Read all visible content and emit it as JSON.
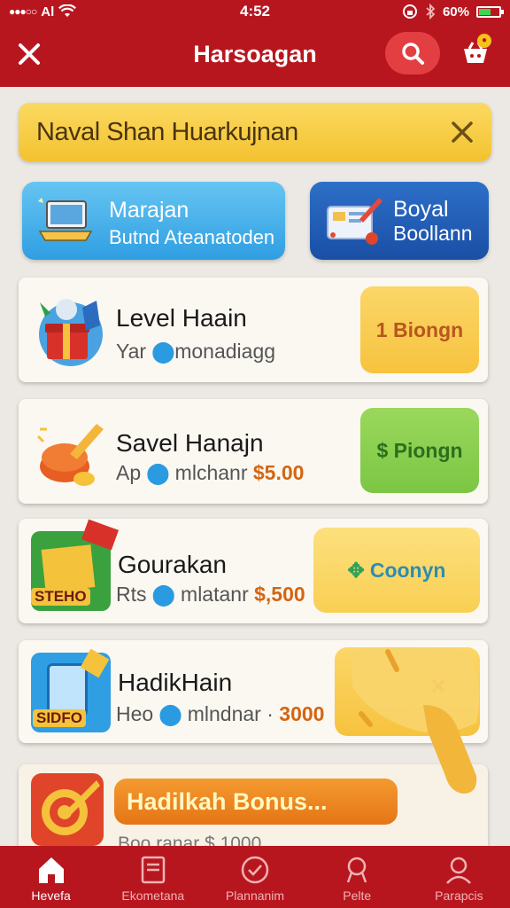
{
  "status_bar": {
    "carrier": "Al",
    "time": "4:52",
    "battery_text": "60%",
    "battery_level": 0.6
  },
  "header": {
    "title": "Harsoagan"
  },
  "banner": {
    "text": "Naval Shan Huarkujnan"
  },
  "quick_cards": [
    {
      "title": "Marajan",
      "subtitle": "Butnd Ateanatoden"
    },
    {
      "title": "Boyal",
      "subtitle": "Boollann"
    }
  ],
  "items": [
    {
      "title": "Level Haain",
      "sub_prefix": "Yar",
      "sub_text": "monadiagg",
      "price": "",
      "action": "1 Biongn"
    },
    {
      "title": "Savel Hanajn",
      "sub_prefix": "Ap",
      "sub_text": "mlchanr",
      "price": "$5.00",
      "action": "$ Piongn"
    },
    {
      "title": "Gourakan",
      "sub_prefix": "Rts",
      "sub_text": "mlatanr",
      "price": "$,500",
      "action": "Coonyn"
    },
    {
      "title": "HadikHain",
      "sub_prefix": "Heo",
      "sub_text": "mlndnar ·",
      "price": "3000",
      "action": ""
    }
  ],
  "icon_badges": {
    "item3": "STEHO",
    "item4": "SIDFO"
  },
  "bonus": {
    "label": "Hadilkah Bonus...",
    "subtitle": "Boo  ranar  $ 1000"
  },
  "nav": [
    {
      "label": "Hevefa",
      "icon": "home-icon",
      "active": true
    },
    {
      "label": "Ekometana",
      "icon": "catalog-icon",
      "active": false
    },
    {
      "label": "Plannanim",
      "icon": "check-circle-icon",
      "active": false
    },
    {
      "label": "Pelte",
      "icon": "pin-icon",
      "active": false
    },
    {
      "label": "Parapcis",
      "icon": "profile-icon",
      "active": false
    }
  ],
  "colors": {
    "brand_red": "#b8161f",
    "banner_yellow": "#f4c230",
    "accent_orange": "#e57517",
    "accent_green": "#7cc644",
    "accent_blue": "#2f9ee2"
  }
}
